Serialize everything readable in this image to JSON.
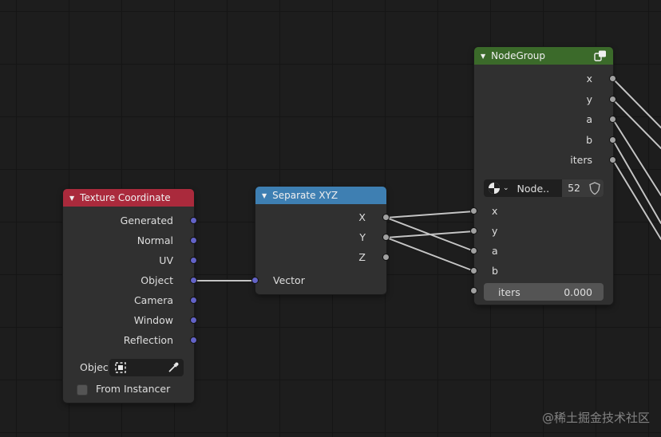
{
  "colors": {
    "background": "#1d1d1d",
    "node_body": "#303030",
    "texture_header": "#aa2a3c",
    "separate_header": "#3e7fb2",
    "group_header": "#3b6a2a",
    "socket_vector": "#6363c7",
    "socket_float": "#a1a1a1",
    "link": "#c8c8c8"
  },
  "texture_coordinate": {
    "title": "Texture Coordinate",
    "outputs": [
      "Generated",
      "Normal",
      "UV",
      "Object",
      "Camera",
      "Window",
      "Reflection"
    ],
    "object_label": "Objec",
    "instancer_label": "From Instancer"
  },
  "separate_xyz": {
    "title": "Separate XYZ",
    "outputs": [
      "X",
      "Y",
      "Z"
    ],
    "input": "Vector"
  },
  "node_group": {
    "title": "NodeGroup",
    "outputs": [
      "x",
      "y",
      "a",
      "b",
      "iters"
    ],
    "datablock_name": "Node..",
    "user_count": "52",
    "inputs": [
      "x",
      "y",
      "a",
      "b"
    ],
    "iters_label": "iters",
    "iters_value": "0.000"
  },
  "watermark": "@稀土掘金技术社区"
}
